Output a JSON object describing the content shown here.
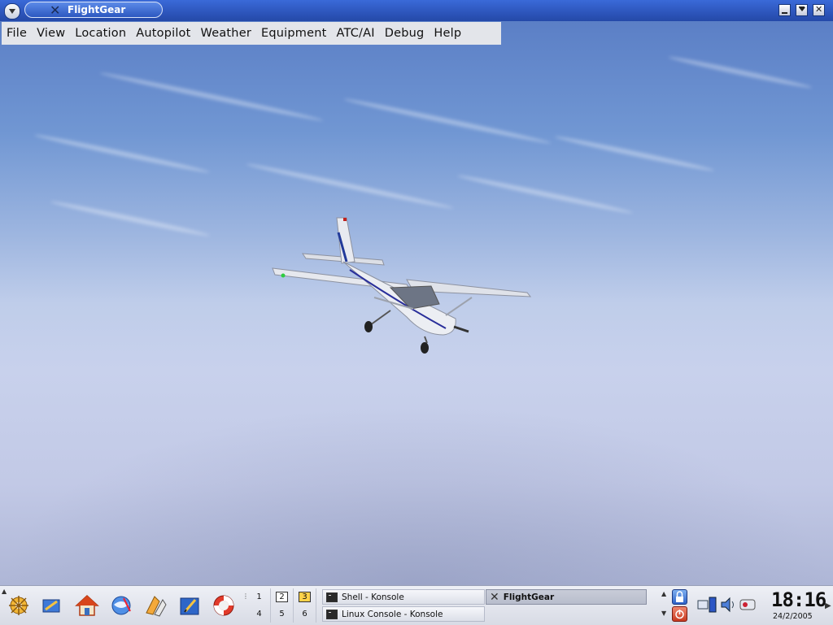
{
  "window": {
    "title": "FlightGear"
  },
  "menubar": {
    "items": [
      "File",
      "View",
      "Location",
      "Autopilot",
      "Weather",
      "Equipment",
      "ATC/AI",
      "Debug",
      "Help"
    ]
  },
  "taskbar": {
    "launchers": [
      "kde-menu-icon",
      "desktop-icon",
      "home-icon",
      "browser-icon",
      "office-icon",
      "editor-icon",
      "help-icon"
    ],
    "pager": {
      "desktops": [
        "1",
        "2",
        "3",
        "4",
        "5",
        "6"
      ],
      "active": "3"
    },
    "tasks": [
      {
        "label": "Shell - Konsole"
      },
      {
        "label": "Linux Console - Konsole"
      },
      {
        "label": "FlightGear"
      }
    ],
    "clock": {
      "time": "18:16",
      "date": "24/2/2005"
    }
  },
  "colors": {
    "titlebar": "#2d55bb",
    "sky_top": "#5b7fc6",
    "sky_bottom": "#c8d1ec",
    "active_desktop": "#ffd24a"
  }
}
